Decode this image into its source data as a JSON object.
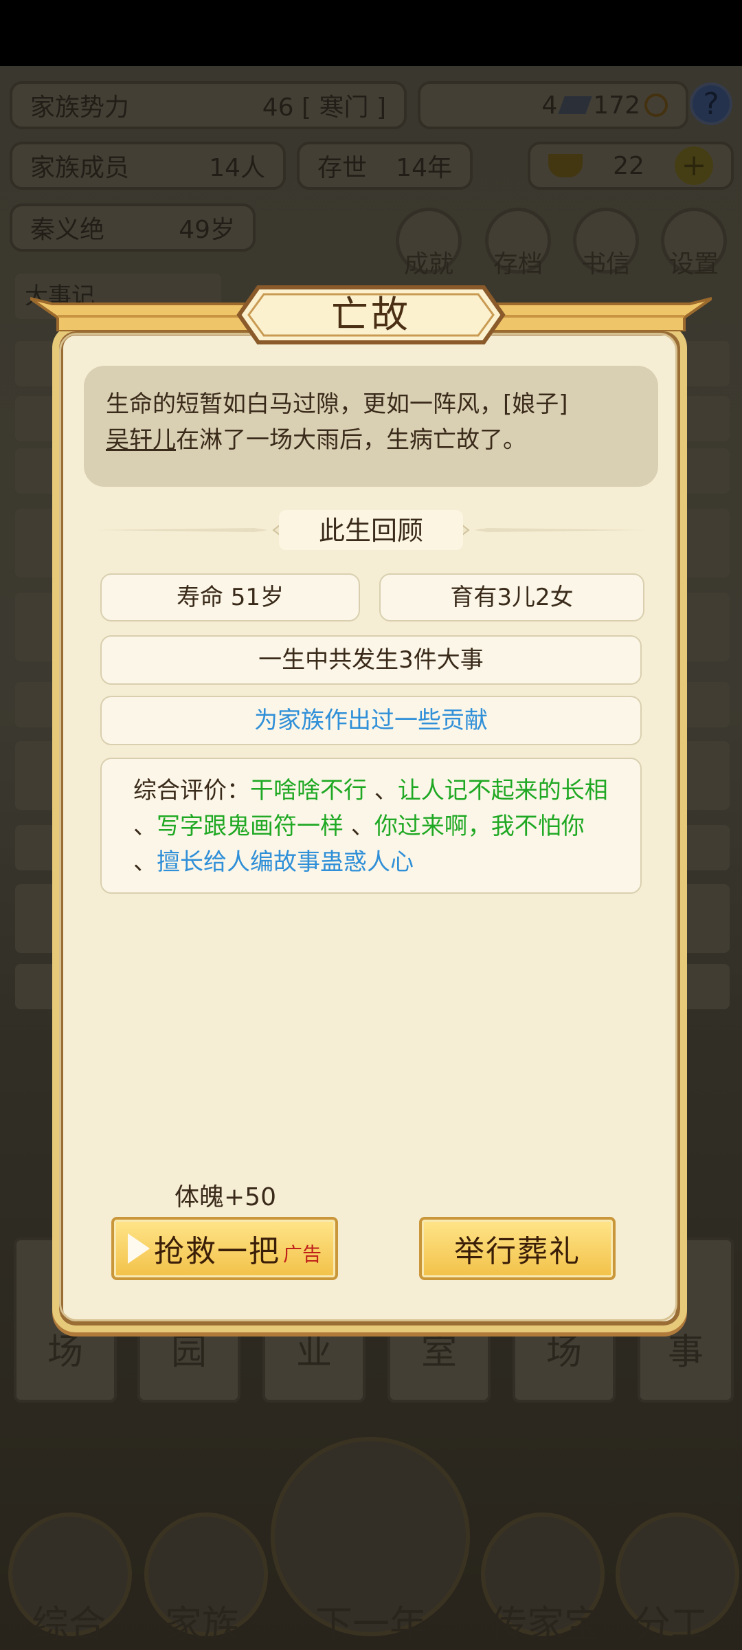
{
  "hud": {
    "family_power_label": "家族势力",
    "family_power_value": "46 [ 寒门 ]",
    "silver": "4",
    "coins": "172",
    "help": "?",
    "members_label": "家族成员",
    "members_value": "14人",
    "existence_label": "存世",
    "existence_value": "14年",
    "gold": "22",
    "patriarch_name": "秦义绝",
    "patriarch_age": "49岁",
    "menu": [
      "成就",
      "存档",
      "书信",
      "设置"
    ]
  },
  "background": {
    "chronicle_tab": "大事记",
    "bottom_tiles": [
      "场",
      "园",
      "业",
      "室",
      "场",
      "事"
    ],
    "nav": [
      "综合",
      "家族",
      "下一年",
      "传家宝",
      "分工"
    ]
  },
  "dialog": {
    "title": "亡故",
    "message_pre": "生命的短暂如白马过隙，更如一阵风，[娘子]",
    "message_name": "吴轩儿",
    "message_post": "在淋了一场大雨后，生病亡故了。",
    "review_heading": "此生回顾",
    "lifespan": "寿命 51岁",
    "children": "育有3儿2女",
    "events": "一生中共发生3件大事",
    "contribution": "为家族作出过一些贡献",
    "eval_label": "综合评价：",
    "traits": [
      {
        "text": "干啥啥不行",
        "color": "green"
      },
      {
        "text": "让人记不起来的长相",
        "color": "green"
      },
      {
        "text": "写字跟鬼画符一样",
        "color": "green"
      },
      {
        "text": "你过来啊，我不怕你",
        "color": "green"
      },
      {
        "text": "擅长给人编故事蛊惑人心",
        "color": "blue"
      }
    ],
    "rescue_hint": "体魄+50",
    "rescue_button": "抢救一把",
    "ad_tag": "广告",
    "funeral_button": "举行葬礼"
  },
  "colors": {
    "green_trait": "#1fa823",
    "blue_trait": "#2f8fd8",
    "dialog_bg": "#f6eed4",
    "button_gold": "#f2c148"
  }
}
